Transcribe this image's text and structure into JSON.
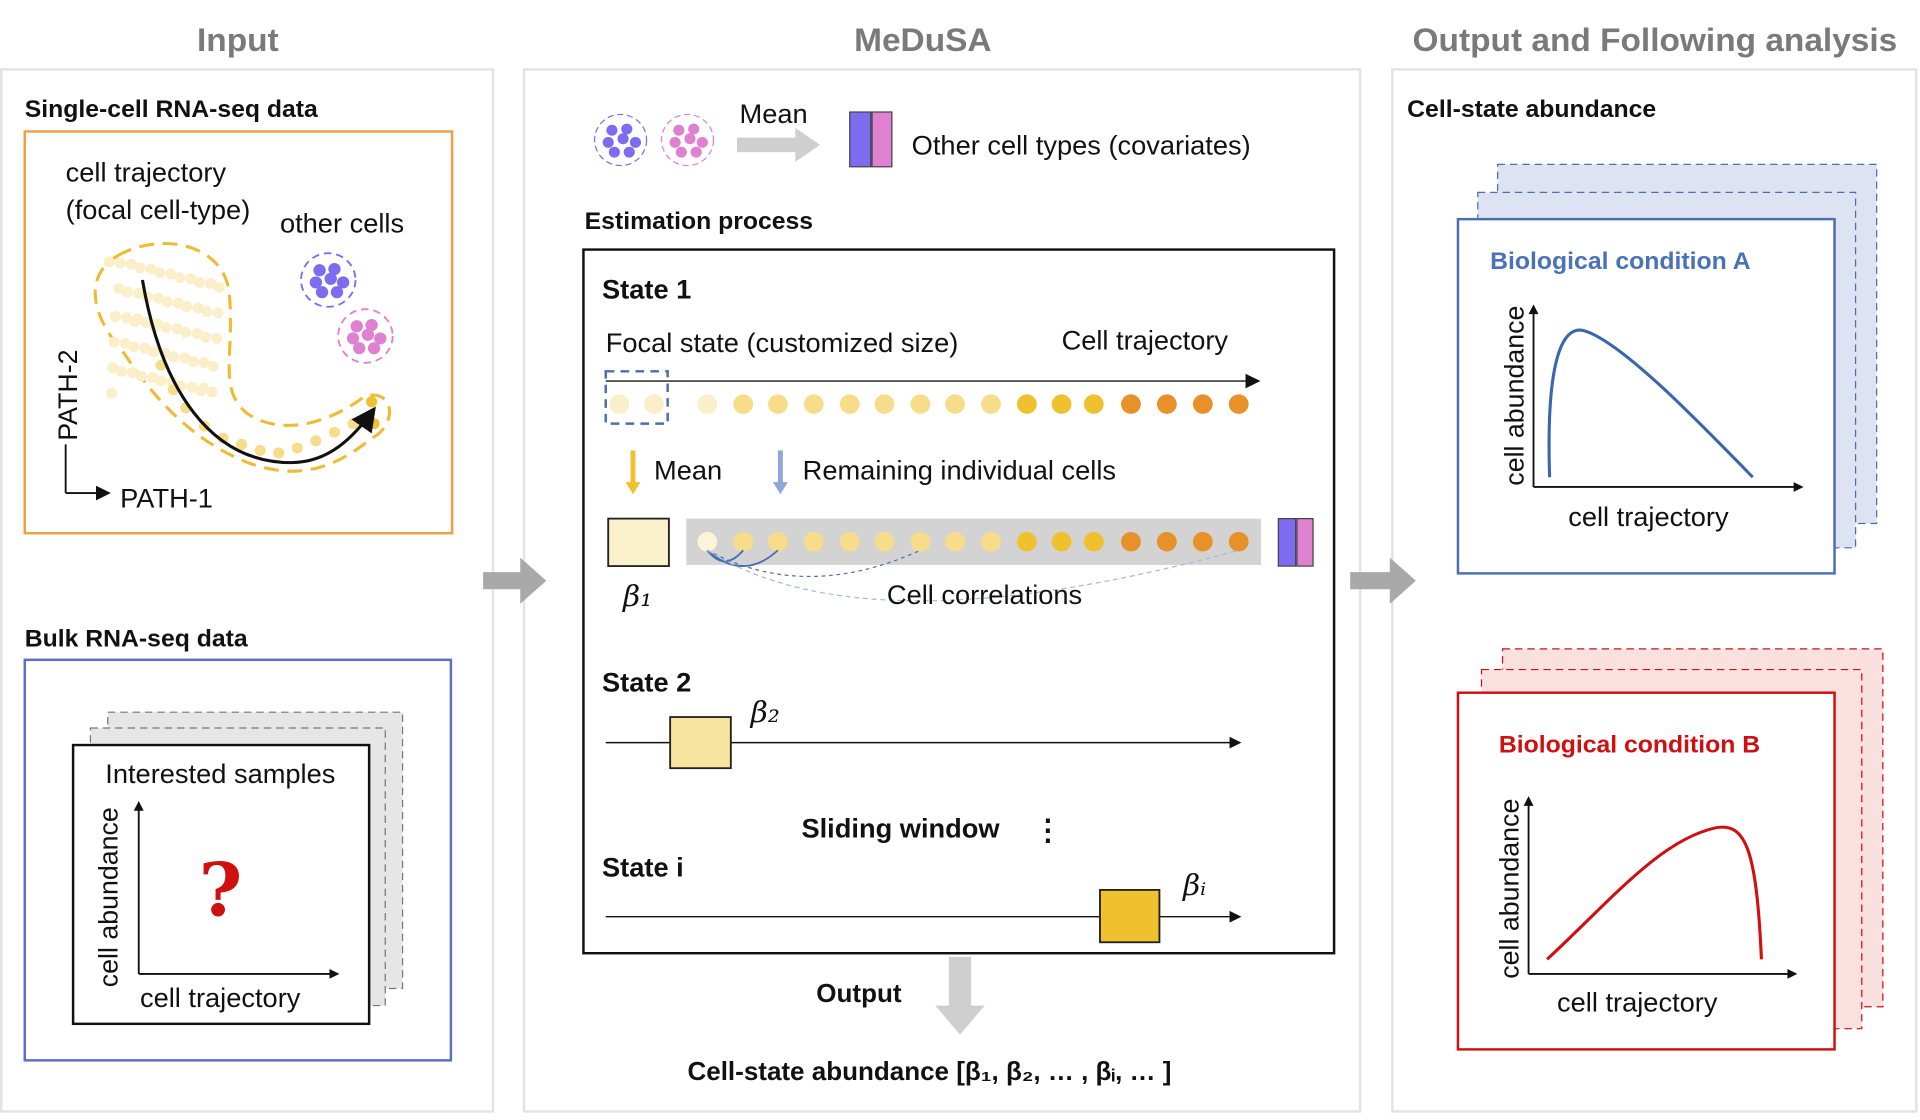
{
  "headers": {
    "input": "Input",
    "medusa": "MeDuSA",
    "output": "Output and Following analysis"
  },
  "input": {
    "sc_title": "Single-cell RNA-seq data",
    "traj_line1": "cell trajectory",
    "traj_line2": "(focal cell-type)",
    "other_cells": "other cells",
    "path1": "PATH-1",
    "path2": "PATH-2",
    "bulk_title": "Bulk RNA-seq data",
    "samples": "Interested samples",
    "ylabel": "cell abundance",
    "xlabel": "cell trajectory",
    "unknown": "?"
  },
  "medusa": {
    "mean_top": "Mean",
    "covariates": "Other cell types (covariates)",
    "estimation": "Estimation process",
    "state1": "State 1",
    "focal": "Focal state (customized size)",
    "cell_traj": "Cell trajectory",
    "mean": "Mean",
    "remaining": "Remaining individual cells",
    "beta1": "β₁",
    "correlations": "Cell correlations",
    "state2": "State 2",
    "beta2": "β₂",
    "sliding": "Sliding window",
    "dots": "⋮",
    "statei": "State i",
    "betai": "βᵢ",
    "output": "Output",
    "result": "Cell-state abundance [β₁, β₂, … , βᵢ, … ]"
  },
  "output": {
    "title": "Cell-state abundance",
    "condA": "Biological condition A",
    "condB": "Biological condition B",
    "ylabel": "cell abundance",
    "xlabel": "cell trajectory"
  },
  "colors": {
    "purple": "#7b6cf0",
    "pink": "#e080d0",
    "orange": "#f0a040",
    "blue": "#4a72b8",
    "red": "#d01010",
    "pale": "#fbefc9",
    "yellow": "#f7dd8a",
    "gold": "#efc12e",
    "dark_orange": "#e8902a"
  }
}
